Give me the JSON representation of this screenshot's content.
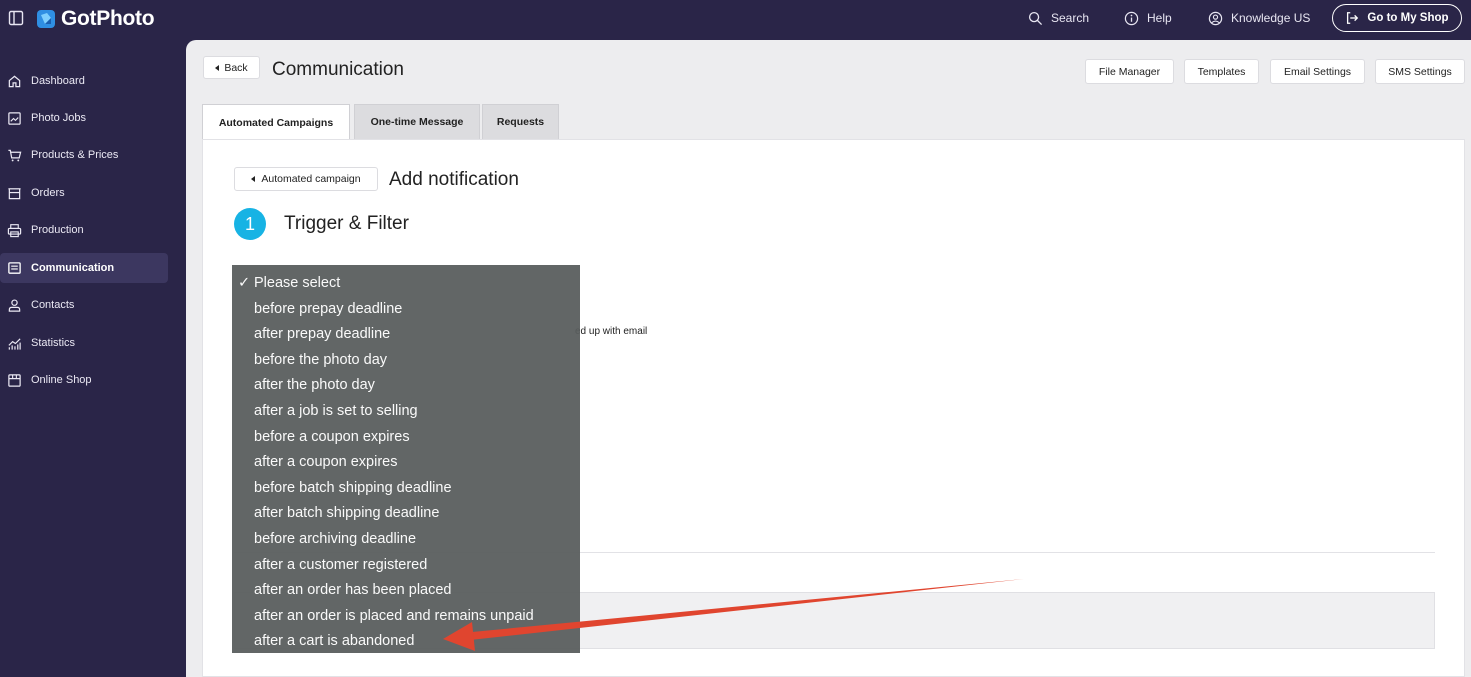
{
  "app": {
    "logo_text": "GotPhoto",
    "brand_color": "#2a2548",
    "accent_color": "#17b3e4"
  },
  "topbar": {
    "search_label": "Search",
    "help_label": "Help",
    "knowledge_label": "Knowledge US",
    "shop_button_label": "Go to My Shop"
  },
  "sidebar": {
    "items": [
      {
        "label": "Dashboard",
        "icon": "home-icon"
      },
      {
        "label": "Photo Jobs",
        "icon": "image-icon"
      },
      {
        "label": "Products & Prices",
        "icon": "cart-icon"
      },
      {
        "label": "Orders",
        "icon": "box-icon"
      },
      {
        "label": "Production",
        "icon": "printer-icon"
      },
      {
        "label": "Communication",
        "icon": "message-icon",
        "active": true
      },
      {
        "label": "Contacts",
        "icon": "user-icon"
      },
      {
        "label": "Statistics",
        "icon": "chart-icon"
      },
      {
        "label": "Online Shop",
        "icon": "store-icon"
      }
    ]
  },
  "header": {
    "back_label": "Back",
    "title": "Communication",
    "buttons": [
      "File Manager",
      "Templates",
      "Email Settings",
      "SMS Settings"
    ]
  },
  "tabs": [
    {
      "label": "Automated Campaigns",
      "active": true
    },
    {
      "label": "One-time Message",
      "active": false
    },
    {
      "label": "Requests",
      "active": false
    }
  ],
  "content": {
    "back_label": "Automated campaign",
    "title": "Add notification",
    "step_number": "1",
    "step_title": "Trigger & Filter",
    "partial_text": "ed up with email"
  },
  "dropdown": {
    "selected_mark": "✓",
    "options": [
      "Please select",
      "before prepay deadline",
      "after prepay deadline",
      "before the photo day",
      "after the photo day",
      "after a job is set to selling",
      "before a coupon expires",
      "after a coupon expires",
      "before batch shipping deadline",
      "after batch shipping deadline",
      "before archiving deadline",
      "after a customer registered",
      "after an order has been placed",
      "after an order is placed and remains unpaid",
      "after a cart is abandoned"
    ],
    "selected_index": 0
  },
  "annotation": {
    "arrow_color": "#e0452f"
  }
}
